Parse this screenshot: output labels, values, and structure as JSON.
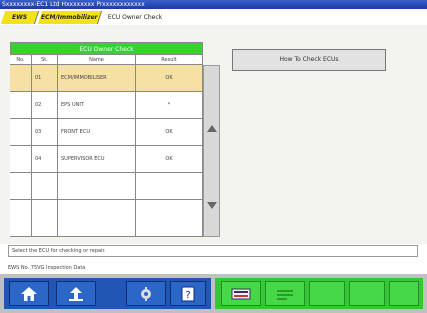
{
  "window": {
    "title": "Sxxxxxxxx-EC1 Ltd Hxxxxxxxx Prxxxxxxxxxxxx"
  },
  "tabs": [
    {
      "label": "EWS"
    },
    {
      "label": "ECM/Immobilizer"
    },
    {
      "label": "ECU Owner Check"
    }
  ],
  "grid": {
    "title": "ECU Owner Check",
    "columns": [
      "No.",
      "St.",
      "Name",
      "Result"
    ],
    "rows": [
      {
        "no": "",
        "st": "01",
        "name": "ECM/IMMOBILISER",
        "result": "OK"
      },
      {
        "no": "",
        "st": "02",
        "name": "EPS UNIT",
        "result": "*"
      },
      {
        "no": "",
        "st": "03",
        "name": "FRONT ECU",
        "result": "OK"
      },
      {
        "no": "",
        "st": "04",
        "name": "SUPERVISOR ECU",
        "result": "OK"
      },
      {
        "no": "",
        "st": "",
        "name": "",
        "result": ""
      },
      {
        "no": "",
        "st": "",
        "name": "",
        "result": ""
      }
    ]
  },
  "howto_button": {
    "label": "How To Check ECUs"
  },
  "message": {
    "text": "Select the ECU for checking or repair."
  },
  "status": {
    "text": "EWS No. 75VG Inspection Data"
  },
  "toolbar": {
    "left_icons": [
      "home-icon",
      "back-icon",
      "tool-icon",
      "help-icon"
    ],
    "right_icons": [
      "ecu-icon",
      "data-icon"
    ]
  }
}
